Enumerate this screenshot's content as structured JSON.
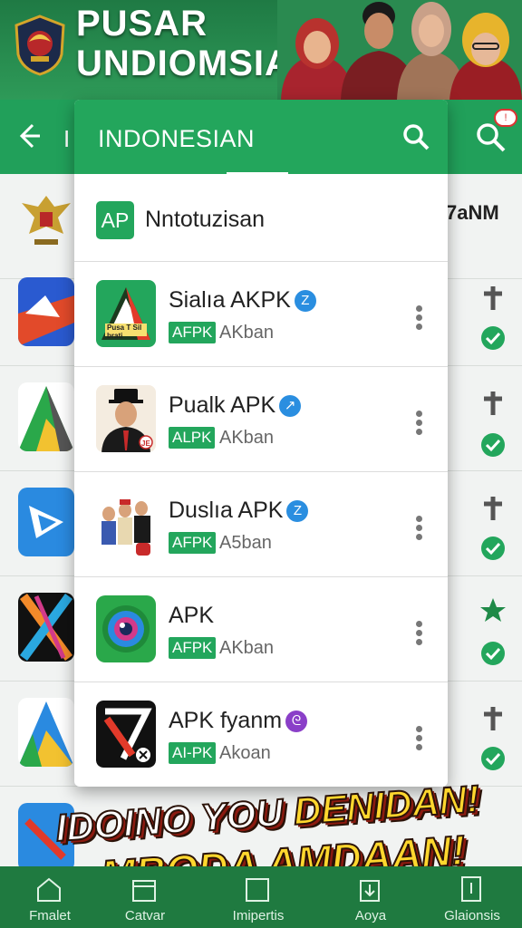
{
  "banner": {
    "title_line1": "PUSAR",
    "title_line2": "UNDIOMSIA"
  },
  "appbar": {
    "back_icon": "arrow-left-icon",
    "bg_letter": "I",
    "notification_badge": "!",
    "right_text": "7aNM"
  },
  "dropdown": {
    "title": "INDONESIAN",
    "search_icon": "search-icon",
    "header_item": {
      "badge": "AP",
      "label": "Nntotuzisan"
    },
    "items": [
      {
        "name": "Sialıa AKPK",
        "verified": "Z",
        "tag": "AFPK",
        "sub": "AKban"
      },
      {
        "name": "Pualk APK",
        "verified": "↗",
        "tag": "ALPK",
        "sub": "AKban"
      },
      {
        "name": "Duslıa APK",
        "verified": "Z",
        "tag": "AFPK",
        "sub": "A5ban"
      },
      {
        "name": "APK",
        "verified": "",
        "tag": "AFPK",
        "sub": "AKban"
      },
      {
        "name": "APK fyanm",
        "verified": "ᘓ",
        "tag": "AI-PK",
        "sub": "Akoan"
      }
    ],
    "item1_icon_text": "Pusa T Sil brati",
    "item2_icon_text": "JE"
  },
  "promo": {
    "line1_a": "IDOINO YOU ",
    "line1_b": "DENIDAN!",
    "line2_a": "MBODA ",
    "line2_b": "AMDAAN!"
  },
  "bottom_nav": [
    {
      "label": "Fmalet",
      "icon": "home-icon"
    },
    {
      "label": "Catvar",
      "icon": "calendar-icon"
    },
    {
      "label": "Imipertis",
      "icon": "apps-icon"
    },
    {
      "label": "Aoya",
      "icon": "download-icon"
    },
    {
      "label": "Glaionsis",
      "icon": "settings-icon"
    }
  ],
  "colors": {
    "primary": "#23a65c",
    "dark_green": "#1f7a40",
    "verified_blue": "#2a8ee0",
    "verified_purple": "#8a3fc8"
  }
}
